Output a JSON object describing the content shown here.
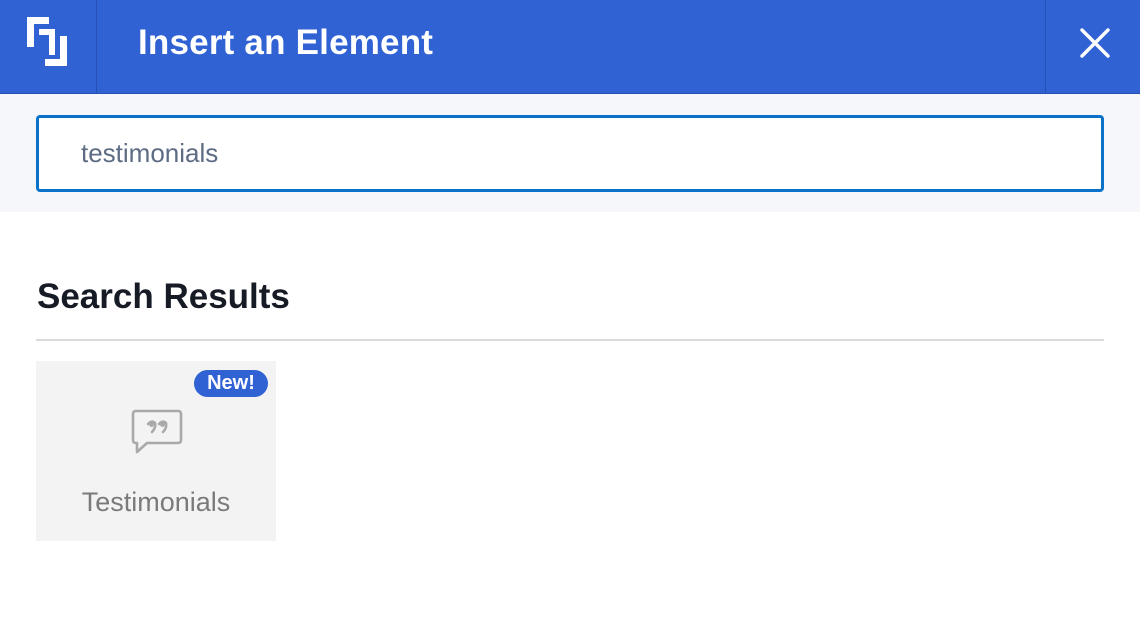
{
  "header": {
    "title": "Insert an Element",
    "logo_icon": "app-logo-icon",
    "close_icon": "close-icon",
    "background_color": "#3062d4"
  },
  "search": {
    "value": "testimonials",
    "placeholder": "",
    "border_color": "#0a72c9"
  },
  "results": {
    "heading": "Search Results",
    "items": [
      {
        "label": "Testimonials",
        "badge": "New!",
        "icon": "quote-bubble-icon"
      }
    ]
  }
}
